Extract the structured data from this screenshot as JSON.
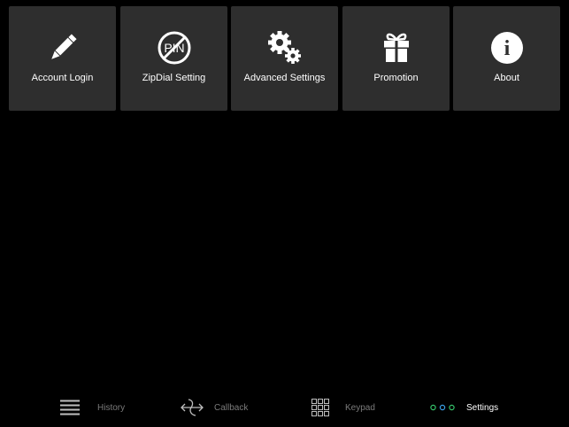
{
  "tiles": [
    {
      "label": "Account Login",
      "icon": "pencil-icon"
    },
    {
      "label": "ZipDial Setting",
      "icon": "no-pin-icon",
      "icon_text": "PIN"
    },
    {
      "label": "Advanced Settings",
      "icon": "gears-icon"
    },
    {
      "label": "Promotion",
      "icon": "gift-icon"
    },
    {
      "label": "About",
      "icon": "info-icon",
      "icon_text": "i"
    }
  ],
  "tabbar": {
    "items": [
      {
        "label": "History",
        "icon": "list-icon",
        "active": false
      },
      {
        "label": "Callback",
        "icon": "callback-arrows-icon",
        "active": false
      },
      {
        "label": "Keypad",
        "icon": "keypad-grid-icon",
        "active": false
      },
      {
        "label": "Settings",
        "icon": "dots-icon",
        "active": true
      }
    ]
  },
  "colors": {
    "background": "#000000",
    "tile_background": "#2e2e2e",
    "tab_inactive_text": "#7a7a7a",
    "tab_active_text": "#ffffff",
    "accent_green": "#35c46a",
    "accent_blue": "#3aa0e8"
  }
}
